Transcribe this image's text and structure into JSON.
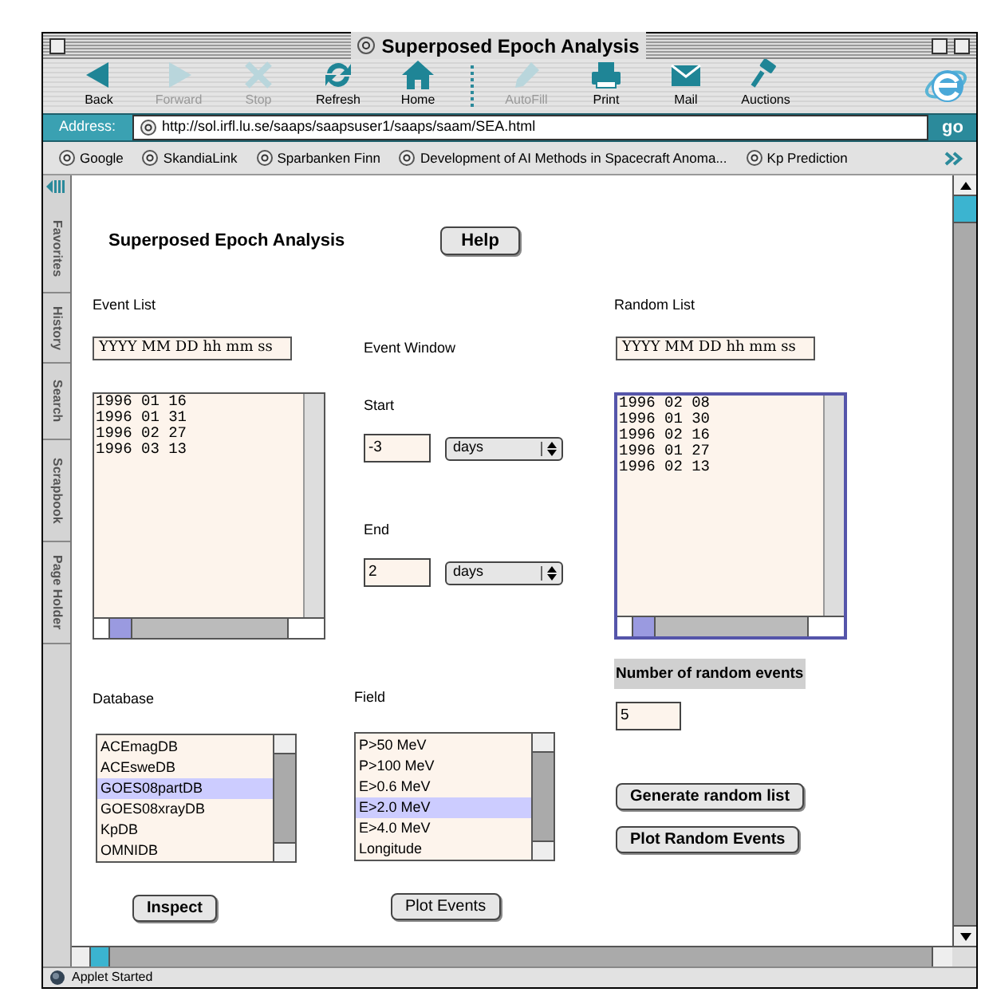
{
  "window": {
    "title": "Superposed Epoch Analysis"
  },
  "toolbar": [
    {
      "kind": "back",
      "label": "Back",
      "disabled": false,
      "separator_before": false
    },
    {
      "kind": "forward",
      "label": "Forward",
      "disabled": true,
      "separator_before": false
    },
    {
      "kind": "stop",
      "label": "Stop",
      "disabled": true,
      "separator_before": false
    },
    {
      "kind": "refresh",
      "label": "Refresh",
      "disabled": false,
      "separator_before": false
    },
    {
      "kind": "home",
      "label": "Home",
      "disabled": false,
      "separator_before": false
    },
    {
      "kind": "autofill",
      "label": "AutoFill",
      "disabled": true,
      "separator_before": true
    },
    {
      "kind": "print",
      "label": "Print",
      "disabled": false,
      "separator_before": false
    },
    {
      "kind": "mail",
      "label": "Mail",
      "disabled": false,
      "separator_before": false
    },
    {
      "kind": "auctions",
      "label": "Auctions",
      "disabled": false,
      "separator_before": false
    }
  ],
  "address_bar": {
    "label": "Address:",
    "url": "http://sol.irfl.lu.se/saaps/saapsuser1/saaps/saam/SEA.html",
    "go": "go"
  },
  "favorites": [
    "Google",
    "SkandiaLink",
    "Sparbanken Finn",
    "Development of AI Methods in Spacecraft Anoma...",
    "Kp Prediction"
  ],
  "sidebar_tabs": [
    "Favorites",
    "History",
    "Search",
    "Scrapbook",
    "Page Holder"
  ],
  "applet": {
    "heading": "Superposed Epoch Analysis",
    "help_button": "Help",
    "event_list": {
      "label": "Event List",
      "format_field": "YYYY MM DD hh mm ss",
      "entries": [
        "1996 01 16",
        "1996 01 31",
        "1996 02 27",
        "1996 03 13"
      ],
      "focused": false
    },
    "event_window": {
      "label": "Event Window",
      "start": {
        "label": "Start",
        "value": "-3",
        "unit": "days"
      },
      "end": {
        "label": "End",
        "value": "2",
        "unit": "days"
      }
    },
    "random_list": {
      "label": "Random List",
      "format_field": "YYYY MM DD hh mm ss",
      "entries": [
        "1996 02 08",
        "1996 01 30",
        "1996 02 16",
        "1996 01 27",
        "1996 02 13"
      ],
      "focused": true
    },
    "number_of_random_events": {
      "label": "Number of random events",
      "value": "5"
    },
    "generate_button": "Generate random list",
    "plot_random_button": "Plot Random Events",
    "database": {
      "label": "Database",
      "items": [
        {
          "label": "ACEmagDB",
          "selected": false
        },
        {
          "label": "ACEsweDB",
          "selected": false
        },
        {
          "label": "GOES08partDB",
          "selected": true
        },
        {
          "label": "GOES08xrayDB",
          "selected": false
        },
        {
          "label": "KpDB",
          "selected": false
        },
        {
          "label": "OMNIDB",
          "selected": false
        }
      ]
    },
    "field": {
      "label": "Field",
      "items": [
        {
          "label": "P>50 MeV",
          "selected": false
        },
        {
          "label": "P>100 MeV",
          "selected": false
        },
        {
          "label": "E>0.6 MeV",
          "selected": false
        },
        {
          "label": "E>2.0 MeV",
          "selected": true
        },
        {
          "label": "E>4.0 MeV",
          "selected": false
        },
        {
          "label": "Longitude",
          "selected": false
        }
      ]
    },
    "inspect_button": "Inspect",
    "plot_events_button": "Plot Events"
  },
  "status_bar": "Applet Started"
}
